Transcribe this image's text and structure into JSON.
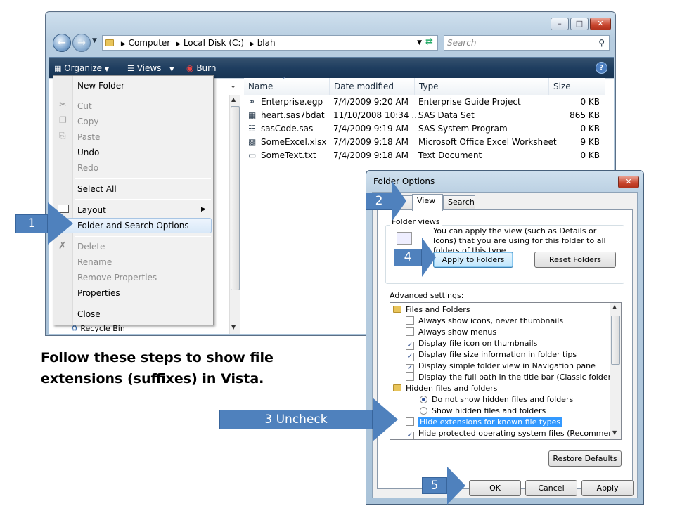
{
  "explorer": {
    "path": [
      "Computer",
      "Local Disk (C:)",
      "blah"
    ],
    "search_placeholder": "Search",
    "toolbar": {
      "organize": "Organize",
      "views": "Views",
      "burn": "Burn"
    },
    "columns": [
      "Name",
      "Date modified",
      "Type",
      "Size"
    ],
    "files": [
      {
        "name": "Enterprise.egp",
        "date": "7/4/2009 9:20 AM",
        "type": "Enterprise Guide Project",
        "size": "0 KB",
        "icon": "egp-file-icon"
      },
      {
        "name": "heart.sas7bdat",
        "date": "11/10/2008 10:34 ...",
        "type": "SAS Data Set",
        "size": "865 KB",
        "icon": "sas-dataset-icon"
      },
      {
        "name": "sasCode.sas",
        "date": "7/4/2009 9:19 AM",
        "type": "SAS System Program",
        "size": "0 KB",
        "icon": "sas-program-icon"
      },
      {
        "name": "SomeExcel.xlsx",
        "date": "7/4/2009 9:18 AM",
        "type": "Microsoft Office Excel Worksheet",
        "size": "9 KB",
        "icon": "excel-file-icon"
      },
      {
        "name": "SomeText.txt",
        "date": "7/4/2009 9:18 AM",
        "type": "Text Document",
        "size": "0 KB",
        "icon": "text-file-icon"
      }
    ],
    "recycle_bin": "Recycle Bin"
  },
  "context_menu": {
    "new_folder": "New Folder",
    "cut": "Cut",
    "copy": "Copy",
    "paste": "Paste",
    "undo": "Undo",
    "redo": "Redo",
    "select_all": "Select All",
    "layout": "Layout",
    "folder_options": "Folder and Search Options",
    "delete": "Delete",
    "rename": "Rename",
    "remove_properties": "Remove Properties",
    "properties": "Properties",
    "close": "Close"
  },
  "dialog": {
    "title": "Folder Options",
    "tab_general": "al",
    "tab_view": "View",
    "tab_search": "Search",
    "folder_views_label": "Folder views",
    "folder_views_text": "You can apply the view (such as Details or Icons) that you are using for this folder to all folders of this type.",
    "apply_button": "Apply to Folders",
    "reset_button": "Reset Folders",
    "advanced_label": "Advanced settings:",
    "settings": [
      {
        "kind": "folder",
        "label": "Files and Folders",
        "checked": false
      },
      {
        "kind": "check",
        "label": "Always show icons, never thumbnails",
        "checked": false
      },
      {
        "kind": "check",
        "label": "Always show menus",
        "checked": false
      },
      {
        "kind": "check",
        "label": "Display file icon on thumbnails",
        "checked": true
      },
      {
        "kind": "check",
        "label": "Display file size information in folder tips",
        "checked": true
      },
      {
        "kind": "check",
        "label": "Display simple folder view in Navigation pane",
        "checked": true
      },
      {
        "kind": "check",
        "label": "Display the full path in the title bar (Classic folders only)",
        "checked": false
      },
      {
        "kind": "folder",
        "label": "Hidden files and folders",
        "checked": false
      },
      {
        "kind": "radio",
        "label": "Do not show hidden files and folders",
        "checked": true
      },
      {
        "kind": "radio",
        "label": "Show hidden files and folders",
        "checked": false
      },
      {
        "kind": "check",
        "label": "Hide extensions for known file types",
        "checked": false
      },
      {
        "kind": "check",
        "label": "Hide protected operating system files (Recommended)",
        "checked": true
      }
    ],
    "restore_button": "Restore Defaults",
    "ok": "OK",
    "cancel": "Cancel",
    "apply": "Apply"
  },
  "callouts": {
    "step1": "1",
    "step2": "2",
    "step3": "3 Uncheck",
    "step4": "4",
    "step5": "5"
  },
  "caption": "Follow these steps to show file extensions (suffixes) in Vista.",
  "colors": {
    "callout": "#4f81bd",
    "highlight": "#3399ff"
  }
}
